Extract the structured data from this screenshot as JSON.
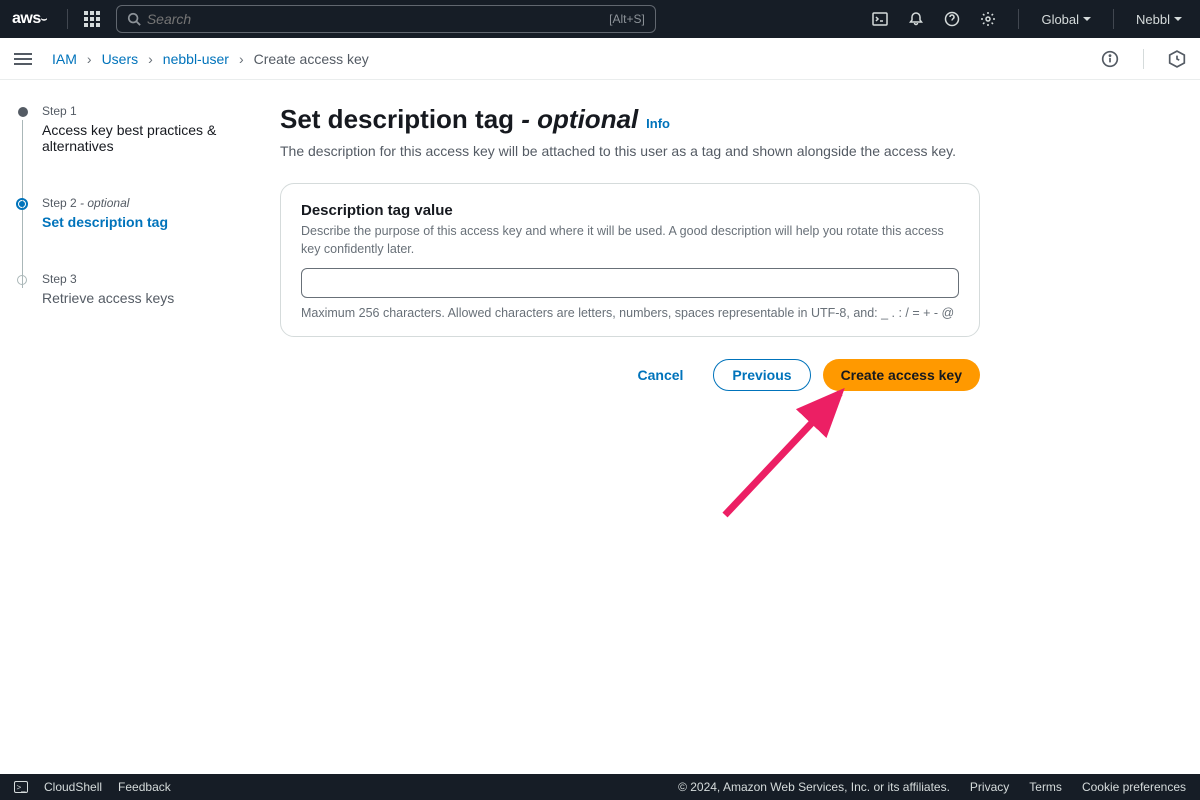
{
  "header": {
    "logo": "aws",
    "search_placeholder": "Search",
    "search_shortcut": "[Alt+S]",
    "region": "Global",
    "user": "Nebbl"
  },
  "breadcrumbs": {
    "items": [
      "IAM",
      "Users",
      "nebbl-user",
      "Create access key"
    ]
  },
  "steps": [
    {
      "label": "Step 1",
      "title": "Access key best practices & alternatives",
      "optional": false
    },
    {
      "label": "Step 2",
      "title": "Set description tag",
      "optional": true,
      "optional_text": "- optional"
    },
    {
      "label": "Step 3",
      "title": "Retrieve access keys",
      "optional": false
    }
  ],
  "page": {
    "heading": "Set description tag",
    "heading_optional": "- optional",
    "info": "Info",
    "subtitle": "The description for this access key will be attached to this user as a tag and shown alongside the access key."
  },
  "panel": {
    "label": "Description tag value",
    "help": "Describe the purpose of this access key and where it will be used. A good description will help you rotate this access key confidently later.",
    "value": "",
    "hint": "Maximum 256 characters. Allowed characters are letters, numbers, spaces representable in UTF-8, and: _ . : / = + - @"
  },
  "actions": {
    "cancel": "Cancel",
    "previous": "Previous",
    "create": "Create access key"
  },
  "footer": {
    "cloudshell": "CloudShell",
    "feedback": "Feedback",
    "copyright": "© 2024, Amazon Web Services, Inc. or its affiliates.",
    "privacy": "Privacy",
    "terms": "Terms",
    "cookies": "Cookie preferences"
  }
}
